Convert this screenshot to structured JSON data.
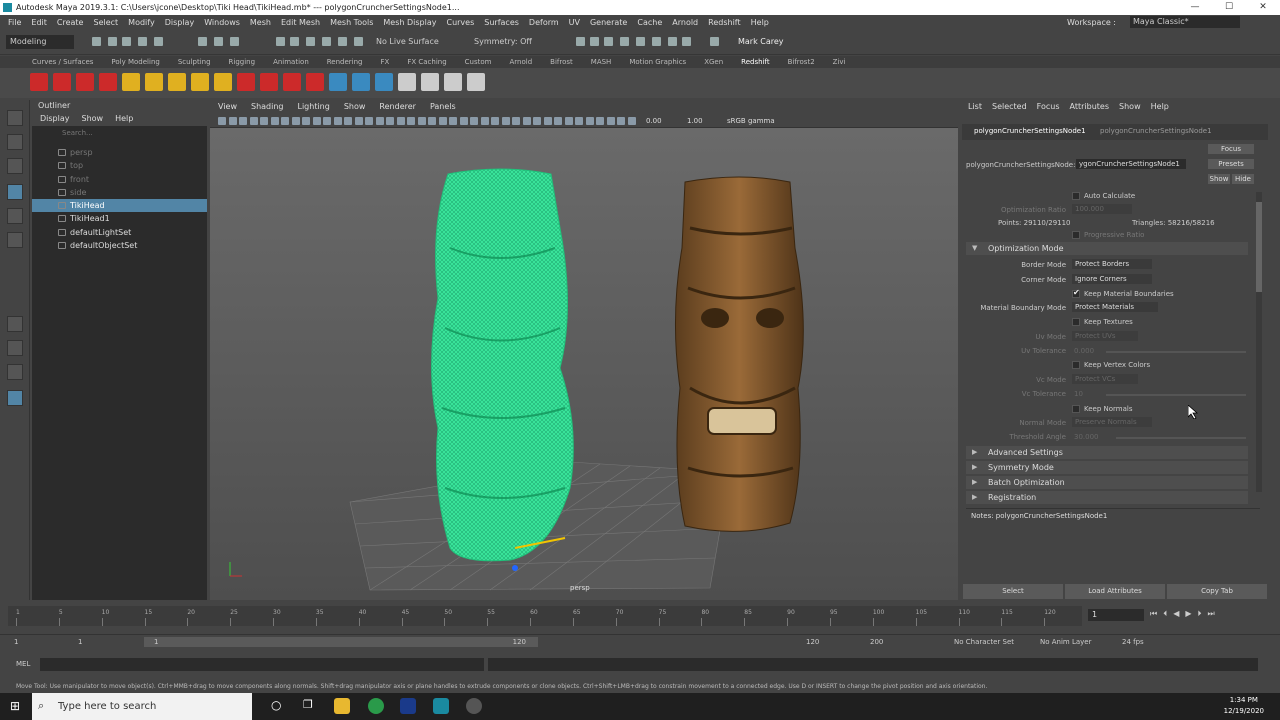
{
  "title_bar": {
    "text": "Autodesk Maya 2019.3.1: C:\\Users\\jcone\\Desktop\\Tiki Head\\TikiHead.mb*  ---  polygonCruncherSettingsNode1..."
  },
  "menu": [
    "File",
    "Edit",
    "Create",
    "Select",
    "Modify",
    "Display",
    "Windows",
    "Mesh",
    "Edit Mesh",
    "Mesh Tools",
    "Mesh Display",
    "Curves",
    "Surfaces",
    "Deform",
    "UV",
    "Generate",
    "Cache",
    "Arnold",
    "Redshift",
    "Help"
  ],
  "workspace": {
    "label": "Workspace :",
    "value": "Maya Classic*"
  },
  "toolbar": {
    "mode": "Modeling",
    "live_surface": "No Live Surface",
    "symmetry": "Symmetry: Off",
    "user": "Mark Carey"
  },
  "shelf_tabs": [
    "Curves / Surfaces",
    "Poly Modeling",
    "Sculpting",
    "Rigging",
    "Animation",
    "Rendering",
    "FX",
    "FX Caching",
    "Custom",
    "Arnold",
    "Bifrost",
    "MASH",
    "Motion Graphics",
    "XGen",
    "Redshift",
    "Bifrost2"
  ],
  "shelf_active": "Redshift",
  "shelf_extra_tab": "Zivi",
  "outliner": {
    "title": "Outliner",
    "menu": [
      "Display",
      "Show",
      "Help"
    ],
    "search_placeholder": "Search...",
    "items": [
      {
        "label": "persp",
        "dim": true
      },
      {
        "label": "top",
        "dim": true
      },
      {
        "label": "front",
        "dim": true
      },
      {
        "label": "side",
        "dim": true
      },
      {
        "label": "TikiHead",
        "selected": true
      },
      {
        "label": "TikiHead1"
      },
      {
        "label": "defaultLightSet"
      },
      {
        "label": "defaultObjectSet"
      }
    ]
  },
  "viewport": {
    "menu": [
      "View",
      "Shading",
      "Lighting",
      "Show",
      "Renderer",
      "Panels"
    ],
    "num1": "0.00",
    "num2": "1.00",
    "colorspace": "sRGB gamma",
    "camera_label": "persp"
  },
  "attr_editor": {
    "menu": [
      "List",
      "Selected",
      "Focus",
      "Attributes",
      "Show",
      "Help"
    ],
    "tab_active": "polygonCruncherSettingsNode1",
    "tab_other": "polygonCruncherSettingsNode1",
    "node_label": "polygonCruncherSettingsNode:",
    "node_value": "ygonCruncherSettingsNode1",
    "focus_btn": "Focus",
    "presets_btn": "Presets",
    "show_btn": "Show",
    "hide_btn": "Hide",
    "auto_calc": "Auto Calculate",
    "opt_ratio": "Optimization Ratio",
    "opt_ratio_val": "100.000",
    "points": "Points: 29110/29110",
    "triangles": "Triangles: 58216/58216",
    "progressive": "Progressive Ratio",
    "opt_mode": "Optimization Mode",
    "border_mode": "Border Mode",
    "border_val": "Protect Borders",
    "corner_mode": "Corner Mode",
    "corner_val": "Ignore Corners",
    "keep_mat": "Keep Material Boundaries",
    "mat_mode": "Material Boundary Mode",
    "mat_val": "Protect Materials",
    "keep_tex": "Keep Textures",
    "uv_mode": "Uv Mode",
    "uv_val": "Protect UVs",
    "uv_tol": "Uv Tolerance",
    "uv_tol_val": "0.000",
    "keep_vc": "Keep Vertex Colors",
    "vc_mode": "Vc Mode",
    "vc_val": "Protect VCs",
    "vc_tol": "Vc Tolerance",
    "vc_tol_val": "10",
    "keep_norm": "Keep Normals",
    "norm_mode": "Normal Mode",
    "norm_val": "Preserve Normals",
    "thresh": "Threshold Angle",
    "thresh_val": "30.000",
    "sections": [
      "Advanced Settings",
      "Symmetry Mode",
      "Batch Optimization",
      "Registration"
    ],
    "notes": "Notes:  polygonCruncherSettingsNode1",
    "buttons": [
      "Select",
      "Load Attributes",
      "Copy Tab"
    ]
  },
  "timeline": {
    "ticks": [
      "1",
      "5",
      "10",
      "15",
      "20",
      "25",
      "30",
      "35",
      "40",
      "45",
      "50",
      "55",
      "60",
      "65",
      "70",
      "75",
      "80",
      "85",
      "90",
      "95",
      "100",
      "105",
      "110",
      "115",
      "120"
    ],
    "current": "1"
  },
  "range": {
    "start": "1",
    "start2": "1",
    "inner": "1",
    "inner_end": "120",
    "end": "120",
    "end2": "200",
    "char_set": "No Character Set",
    "anim_layer": "No Anim Layer",
    "fps": "24 fps"
  },
  "mel": {
    "label": "MEL"
  },
  "help_line": "Move Tool: Use manipulator to move object(s). Ctrl+MMB+drag to move components along normals. Shift+drag manipulator axis or plane handles to extrude components or clone objects. Ctrl+Shift+LMB+drag to constrain movement to a connected edge. Use D or INSERT to change the pivot position and axis orientation.",
  "taskbar": {
    "search": "Type here to search",
    "time": "1:34 PM",
    "date": "12/19/2020"
  }
}
